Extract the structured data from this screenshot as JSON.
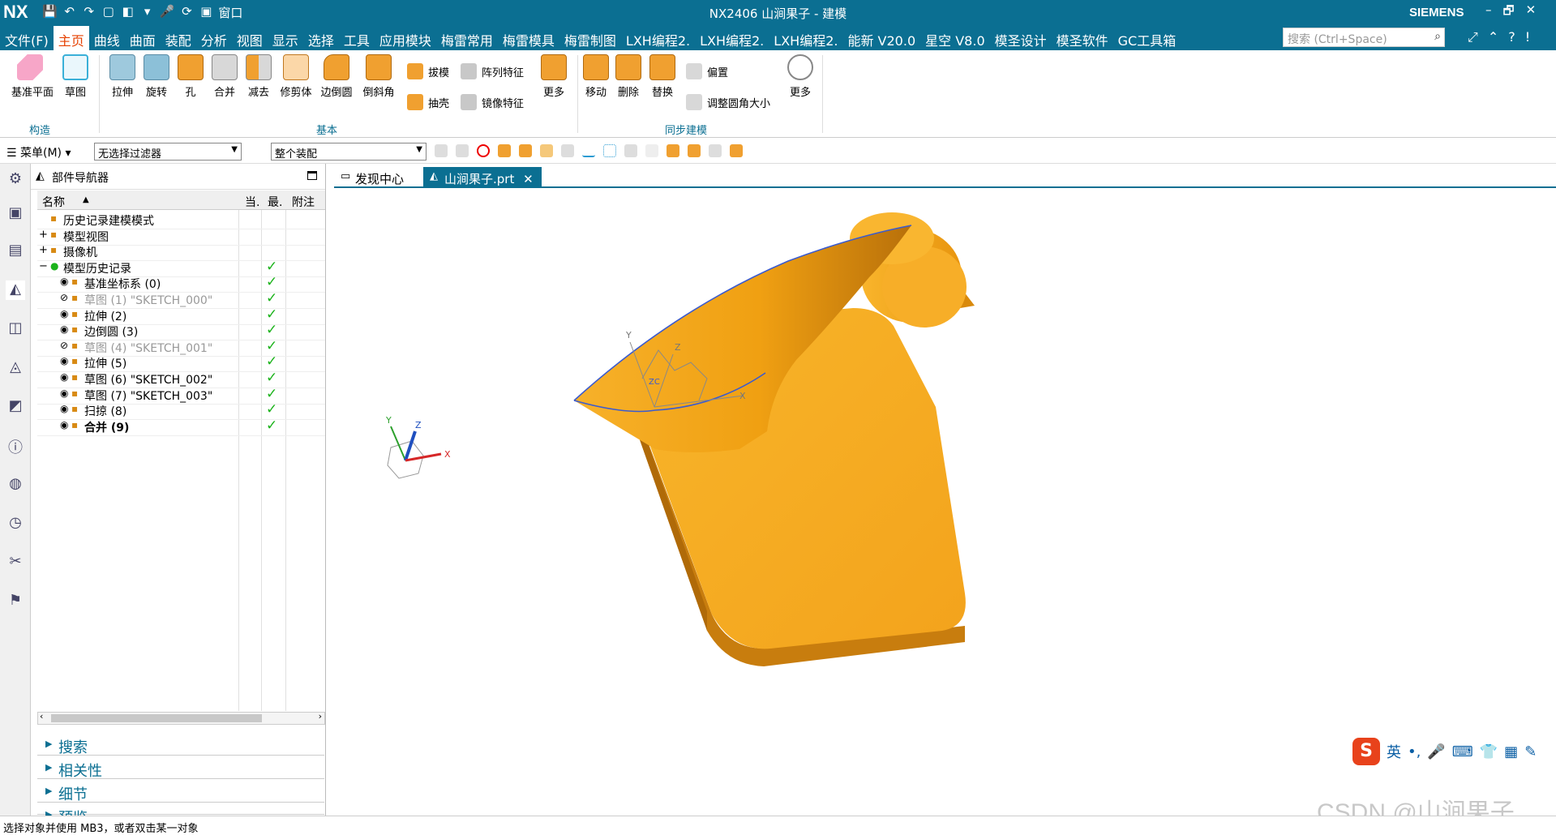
{
  "titlebar": {
    "logo": "NX",
    "title": "NX2406 山涧果子 - 建模",
    "brand": "SIEMENS",
    "quick_access": [
      "💾",
      "↶",
      "↷",
      "▢",
      "◧",
      "▾",
      "🎤",
      "⟳",
      "▣"
    ],
    "window_menu": "窗口",
    "window_controls": [
      "–",
      "🗗",
      "✕"
    ]
  },
  "menubar": {
    "items": [
      "文件(F)",
      "主页",
      "曲线",
      "曲面",
      "装配",
      "分析",
      "视图",
      "显示",
      "选择",
      "工具",
      "应用模块",
      "梅雷常用",
      "梅雷模具",
      "梅雷制图",
      "LXH编程2.",
      "LXH编程2.",
      "LXH编程2.",
      "能新 V20.0",
      "星空 V8.0",
      "模圣设计",
      "模圣软件",
      "GC工具箱"
    ],
    "active_index": 1,
    "search_placeholder": "搜索 (Ctrl+Space)",
    "right_icons": [
      "⤢",
      "⌃",
      "?",
      "!"
    ]
  },
  "ribbon": {
    "construct": {
      "label": "构造",
      "tools": [
        "基准平面",
        "草图"
      ]
    },
    "basic": {
      "label": "基本",
      "tools": [
        "拉伸",
        "旋转",
        "孔",
        "合并",
        "减去",
        "修剪体",
        "边倒圆",
        "倒斜角"
      ],
      "small_tools": [
        "拔模",
        "阵列特征",
        "抽壳",
        "镜像特征"
      ],
      "more": "更多"
    },
    "sync": {
      "label": "同步建模",
      "tools": [
        "移动",
        "删除",
        "替换"
      ],
      "small_tools": [
        "偏置",
        "调整圆角大小"
      ],
      "more": "更多"
    }
  },
  "toolbar2": {
    "menu_label": "☰ 菜单(M) ▾",
    "filter_value": "无选择过滤器",
    "scope_value": "整个装配"
  },
  "navigator": {
    "title": "部件导航器",
    "columns": [
      "名称",
      "当.",
      "最.",
      "附注"
    ],
    "rows": [
      {
        "label": "历史记录建模模式",
        "indent": 1,
        "check": false,
        "gray": false,
        "eye": false
      },
      {
        "label": "模型视图",
        "indent": 0,
        "check": false,
        "gray": false,
        "eye": false,
        "expander": "+"
      },
      {
        "label": "摄像机",
        "indent": 0,
        "check": false,
        "gray": false,
        "eye": false,
        "expander": "+"
      },
      {
        "label": "模型历史记录",
        "indent": 0,
        "check": true,
        "gray": false,
        "eye": false,
        "expander": "−"
      },
      {
        "label": "基准坐标系 (0)",
        "indent": 2,
        "check": true,
        "gray": false,
        "eye": true
      },
      {
        "label": "草图 (1) \"SKETCH_000\"",
        "indent": 2,
        "check": true,
        "gray": true,
        "eye": true
      },
      {
        "label": "拉伸 (2)",
        "indent": 2,
        "check": true,
        "gray": false,
        "eye": true
      },
      {
        "label": "边倒圆 (3)",
        "indent": 2,
        "check": true,
        "gray": false,
        "eye": true
      },
      {
        "label": "草图 (4) \"SKETCH_001\"",
        "indent": 2,
        "check": true,
        "gray": true,
        "eye": true
      },
      {
        "label": "拉伸 (5)",
        "indent": 2,
        "check": true,
        "gray": false,
        "eye": true
      },
      {
        "label": "草图 (6) \"SKETCH_002\"",
        "indent": 2,
        "check": true,
        "gray": false,
        "eye": true
      },
      {
        "label": "草图 (7) \"SKETCH_003\"",
        "indent": 2,
        "check": true,
        "gray": false,
        "eye": true
      },
      {
        "label": "扫掠 (8)",
        "indent": 2,
        "check": true,
        "gray": false,
        "eye": true
      },
      {
        "label": "合并 (9)",
        "indent": 2,
        "check": true,
        "gray": false,
        "eye": true,
        "bold": true
      }
    ],
    "accordion": [
      "搜索",
      "相关性",
      "细节",
      "预览"
    ]
  },
  "tabs": [
    {
      "label": "发现中心",
      "active": false
    },
    {
      "label": "山涧果子.prt",
      "active": true,
      "close": "✕"
    }
  ],
  "triad": {
    "x": "X",
    "y": "Y",
    "z": "Z"
  },
  "model_csys": {
    "x": "X",
    "y": "Y",
    "z": "Z",
    "zc": "ZC"
  },
  "ime": {
    "label": "英",
    "icons": [
      "•,",
      "🎤",
      "⌨",
      "👕",
      "▦",
      "✎"
    ]
  },
  "statusbar": {
    "text": "选择对象并使用 MB3，或者双击某一对象"
  },
  "watermark": "CSDN @山涧果子",
  "colors": {
    "accent": "#0b6f92",
    "model": "#f5a623",
    "check": "#1bb31b"
  }
}
